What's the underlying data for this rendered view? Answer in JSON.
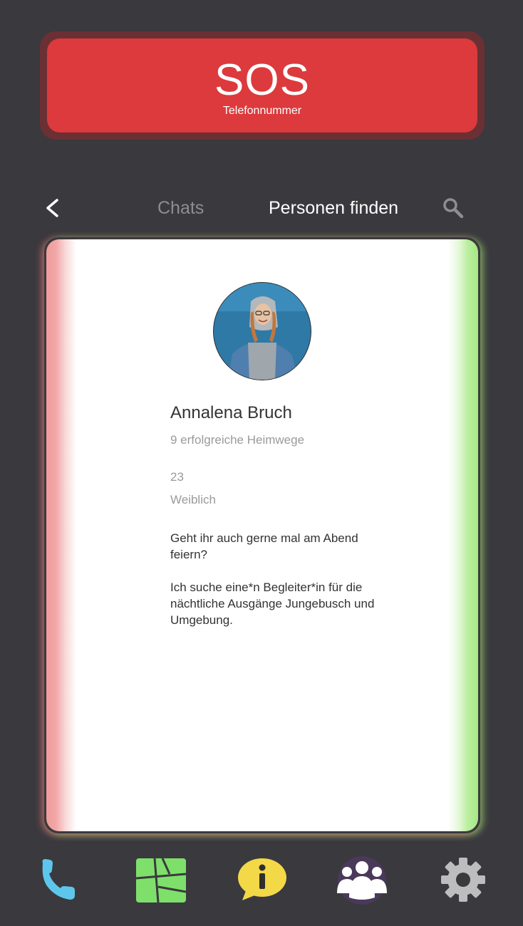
{
  "sos": {
    "title": "SOS",
    "subtitle": "Telefonnummer"
  },
  "topnav": {
    "tabs": [
      "Chats",
      "Personen finden"
    ],
    "active_tab": "Personen finden"
  },
  "profile": {
    "name": "Annalena Bruch",
    "homeways": "9 erfolgreiche Heimwege",
    "age": "23",
    "gender": "Weiblich",
    "bio": [
      "Geht ihr auch gerne mal am Abend feiern?",
      "Ich suche eine*n Begleiter*in für die nächtliche Ausgänge Jungebusch und Umgebung."
    ]
  },
  "bottomnav": {
    "items": [
      "phone-icon",
      "map-icon",
      "info-icon",
      "people-icon",
      "gear-icon"
    ],
    "active": "people-icon"
  },
  "colors": {
    "background": "#3a393e",
    "sos": "#dc3a3c",
    "swipe_left": "#ee9a9a",
    "swipe_right": "#a6e884",
    "phone": "#5ec6ea",
    "map": "#7ee06a",
    "info": "#f3d847",
    "people_active": "#9a4fd6",
    "gear": "#bdbdbd"
  }
}
